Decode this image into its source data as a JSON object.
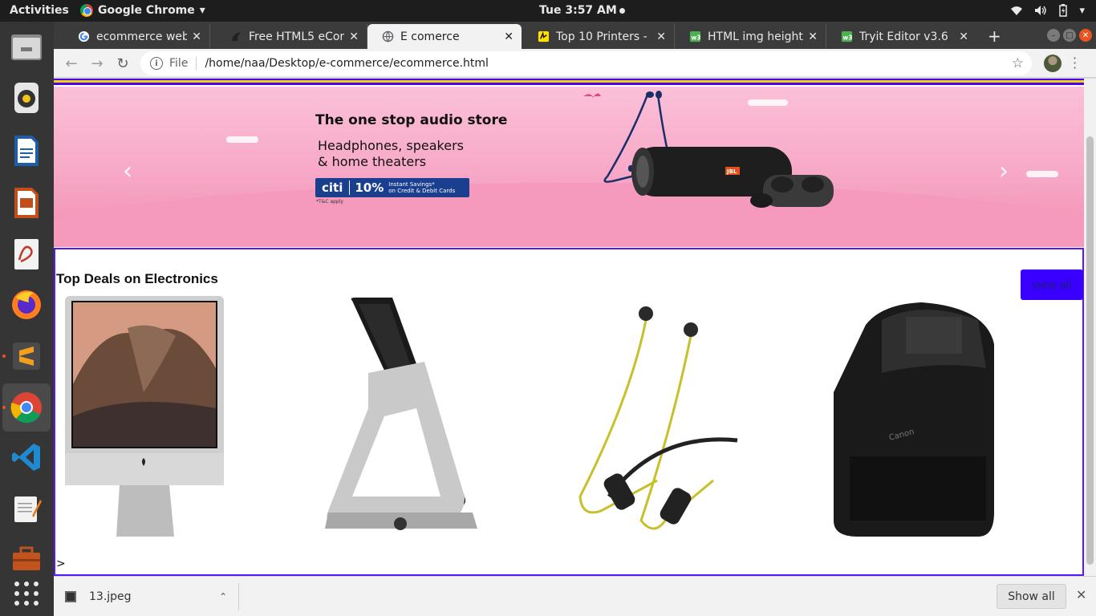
{
  "topbar": {
    "activities": "Activities",
    "app_menu": "Google Chrome",
    "clock": "Tue  3:57 AM"
  },
  "dock": {
    "items": [
      "files-icon",
      "rhythmbox-icon",
      "writer-icon",
      "impress-icon",
      "document-viewer-icon",
      "firefox-icon",
      "sublime-text-icon",
      "chrome-icon",
      "vscode-icon",
      "text-editor-icon",
      "toolbox-icon",
      "app-grid-icon"
    ]
  },
  "tabs": [
    {
      "title": "ecommerce websit",
      "icon": "google-icon"
    },
    {
      "title": "Free HTML5 eCom",
      "icon": "template-icon"
    },
    {
      "title": "E comerce",
      "icon": "globe-icon"
    },
    {
      "title": "Top 10 Printers - B",
      "icon": "bestbuy-icon"
    },
    {
      "title": "HTML img height A",
      "icon": "w3schools-icon"
    },
    {
      "title": "Tryit Editor v3.6",
      "icon": "w3schools-icon"
    }
  ],
  "omnibox": {
    "scheme": "File",
    "url": "/home/naa/Desktop/e-commerce/ecommerce.html"
  },
  "banner": {
    "heading": "The one stop audio store",
    "sub_line1": "Headphones, speakers",
    "sub_line2": "& home theaters",
    "bank": "citi",
    "discount": "10%",
    "offer_line1": "Instant Savings*",
    "offer_line2": "on Credit & Debit Cards",
    "tnc": "*T&C apply",
    "speaker_brand": "JBL"
  },
  "deals": {
    "title": "Top Deals on Electronics",
    "view_all": "view all",
    "products": [
      "imac-image",
      "phone-stand-image",
      "neckband-earphones-image",
      "printer-image"
    ],
    "stray_text": ">"
  },
  "downloads": {
    "file": "13.jpeg",
    "show_all": "Show all"
  },
  "colors": {
    "accent_purple": "#3a00ff",
    "banner_pink": "#f7a8c6",
    "navbar_yellow": "#f0d400"
  }
}
